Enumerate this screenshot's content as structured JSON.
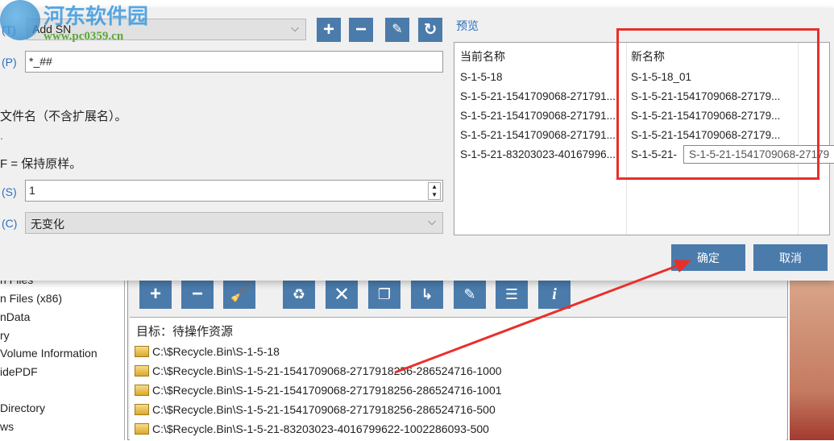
{
  "watermark": {
    "name": "河东软件园",
    "url": "www.pc0359.cn"
  },
  "dialog": {
    "mode_label": "(T)",
    "mode_value": "Add SN",
    "pattern_label": "(P)",
    "pattern_value": "*_##",
    "help_line1": "文件名（不含扩展名）。",
    "help_line2": ".",
    "help_line3": "F = 保持原样。",
    "start_label": "(S)",
    "start_value": "1",
    "case_label": "(C)",
    "case_value": "无变化",
    "preview_label": "预览",
    "preview": {
      "headers": [
        "当前名称",
        "新名称"
      ],
      "rows": [
        [
          "S-1-5-18",
          "S-1-5-18_01"
        ],
        [
          "S-1-5-21-1541709068-271791...",
          "S-1-5-21-1541709068-27179..."
        ],
        [
          "S-1-5-21-1541709068-271791...",
          "S-1-5-21-1541709068-27179..."
        ],
        [
          "S-1-5-21-1541709068-271791...",
          "S-1-5-21-1541709068-27179..."
        ],
        [
          "S-1-5-21-83203023-40167996...",
          "S-1-5-21-"
        ]
      ]
    },
    "tooltip": "S-1-5-21-1541709068-27179",
    "ok": "确定",
    "cancel": "取消"
  },
  "tree": [
    "n Files",
    "n Files (x86)",
    "nData",
    "ry",
    "Volume Information",
    "idePDF",
    "",
    "Directory",
    "ws"
  ],
  "list": {
    "header": "目标：待操作资源",
    "rows": [
      "C:\\$Recycle.Bin\\S-1-5-18",
      "C:\\$Recycle.Bin\\S-1-5-21-1541709068-2717918256-286524716-1000",
      "C:\\$Recycle.Bin\\S-1-5-21-1541709068-2717918256-286524716-1001",
      "C:\\$Recycle.Bin\\S-1-5-21-1541709068-2717918256-286524716-500",
      "C:\\$Recycle.Bin\\S-1-5-21-83203023-4016799622-1002286093-500"
    ]
  },
  "colors": {
    "accent": "#4a7bab",
    "highlight": "#e8302a"
  }
}
